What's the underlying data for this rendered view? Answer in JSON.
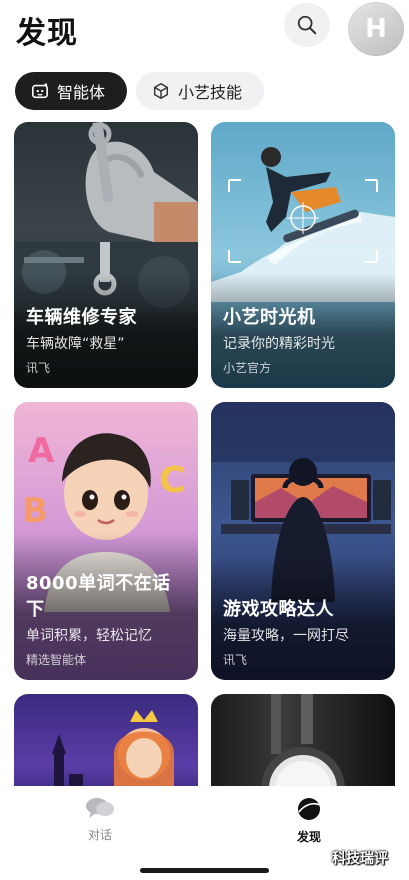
{
  "header": {
    "title": "发现",
    "avatar_letter": "H"
  },
  "tabs": [
    {
      "label": "智能体",
      "icon": "robot-icon",
      "active": true
    },
    {
      "label": "小艺技能",
      "icon": "cube-icon",
      "active": false
    }
  ],
  "cards": [
    {
      "title": "车辆维修专家",
      "subtitle": "车辆故障“救星”",
      "source": "讯飞"
    },
    {
      "title": "小艺时光机",
      "subtitle": "记录你的精彩时光",
      "source": "小艺官方"
    },
    {
      "title": "8000单词不在话下",
      "subtitle": "单词积累，轻松记忆",
      "source": "精选智能体"
    },
    {
      "title": "游戏攻略达人",
      "subtitle": "海量攻略，一网打尽",
      "source": "讯飞"
    }
  ],
  "bottom_nav": [
    {
      "label": "对话",
      "icon": "chat-bubbles-icon",
      "active": false
    },
    {
      "label": "发现",
      "icon": "discover-planet-icon",
      "active": true
    }
  ],
  "watermark": "科技瑞评",
  "colors": {
    "active_tab_bg": "#1e1e1f",
    "inactive_tab_bg": "#f1f1f3"
  }
}
